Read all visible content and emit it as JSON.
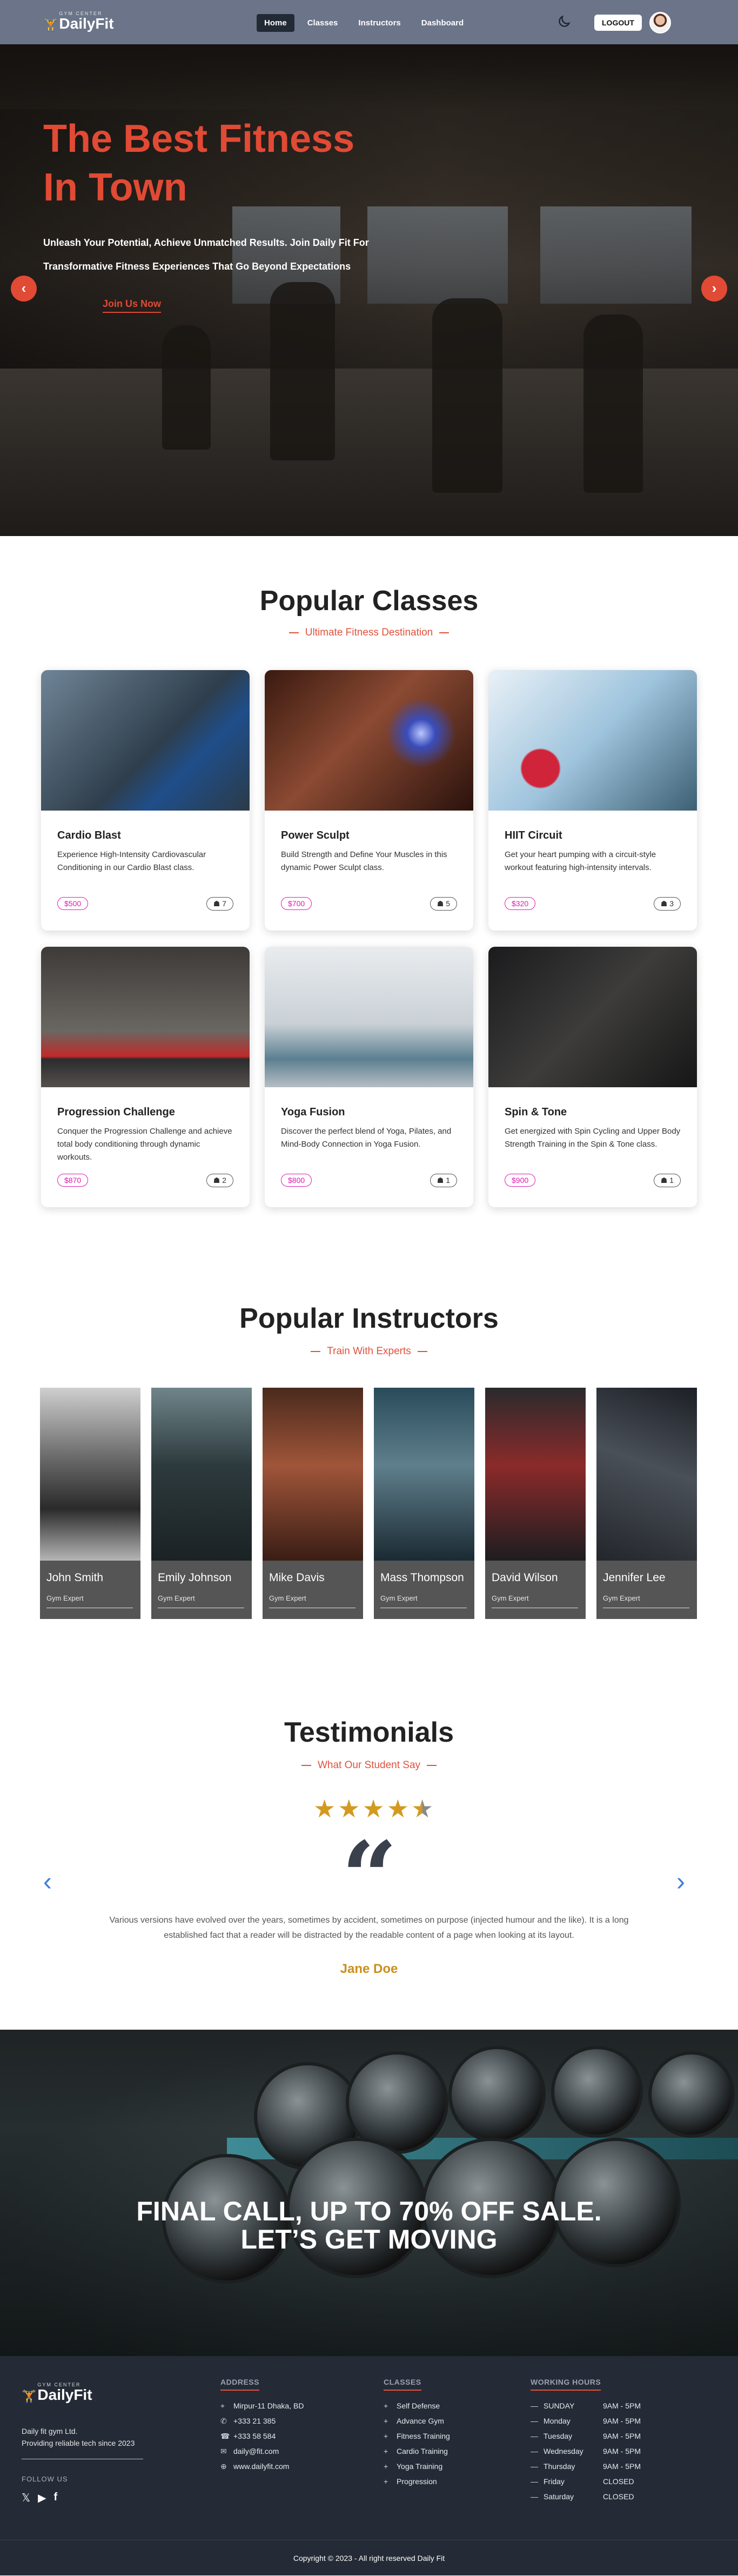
{
  "nav": {
    "logo_small": "GYM CENTER",
    "logo_big": "DailyFit",
    "links": [
      {
        "label": "Home",
        "active": true
      },
      {
        "label": "Classes",
        "active": false
      },
      {
        "label": "Instructors",
        "active": false
      },
      {
        "label": "Dashboard",
        "active": false
      }
    ],
    "logout_label": "LOGOUT"
  },
  "hero": {
    "title_line1": "The Best Fitness",
    "title_line2": "In Town",
    "subtitle": "Unleash Your Potential, Achieve Unmatched Results. Join Daily Fit For Transformative Fitness Experiences That Go Beyond Expectations",
    "cta": "Join Us Now",
    "prev_icon": "‹",
    "next_icon": "›",
    "accent": "#e14a34"
  },
  "classes": {
    "title": "Popular Classes",
    "subtitle": "Ultimate Fitness Destination",
    "items": [
      {
        "name": "Cardio Blast",
        "desc": "Experience High-Intensity Cardiovascular Conditioning in our Cardio Blast class.",
        "price": "$500",
        "seats": "7"
      },
      {
        "name": "Power Sculpt",
        "desc": "Build Strength and Define Your Muscles in this dynamic Power Sculpt class.",
        "price": "$700",
        "seats": "5"
      },
      {
        "name": "HIIT Circuit",
        "desc": "Get your heart pumping with a circuit-style workout featuring high-intensity intervals.",
        "price": "$320",
        "seats": "3"
      },
      {
        "name": "Progression Challenge",
        "desc": "Conquer the Progression Challenge and achieve total body conditioning through dynamic workouts.",
        "price": "$870",
        "seats": "2"
      },
      {
        "name": "Yoga Fusion",
        "desc": "Discover the perfect blend of Yoga, Pilates, and Mind-Body Connection in Yoga Fusion.",
        "price": "$800",
        "seats": "1"
      },
      {
        "name": "Spin & Tone",
        "desc": "Get energized with Spin Cycling and Upper Body Strength Training in the Spin & Tone class.",
        "price": "$900",
        "seats": "1"
      }
    ]
  },
  "instructors": {
    "title": "Popular Instructors",
    "subtitle": "Train With Experts",
    "items": [
      {
        "name": "John Smith",
        "role": "Gym Expert"
      },
      {
        "name": "Emily Johnson",
        "role": "Gym Expert"
      },
      {
        "name": "Mike Davis",
        "role": "Gym Expert"
      },
      {
        "name": "Mass Thompson",
        "role": "Gym Expert"
      },
      {
        "name": "David Wilson",
        "role": "Gym Expert"
      },
      {
        "name": "Jennifer Lee",
        "role": "Gym Expert"
      }
    ]
  },
  "testimonials": {
    "title": "Testimonials",
    "subtitle": "What Our Student Say",
    "rating": 4.5,
    "text": "Various versions have evolved over the years, sometimes by accident, sometimes on purpose (injected humour and the like). It is a long established fact that a reader will be distracted by the readable content of a page when looking at its layout.",
    "name": "Jane Doe",
    "prev_icon": "‹",
    "next_icon": "›"
  },
  "sale": {
    "line1": "FINAL CALL, UP TO 70% OFF SALE.",
    "line2": "LET’S GET MOVING"
  },
  "footer": {
    "tagline1": "Daily fit gym Ltd.",
    "tagline2": "Providing reliable tech since 2023",
    "follow": "FOLLOW US",
    "address_title": "ADDRESS",
    "address": [
      {
        "icon": "⌖",
        "text": "Mirpur-11 Dhaka, BD"
      },
      {
        "icon": "✆",
        "text": "+333 21 385"
      },
      {
        "icon": "☎",
        "text": "+333 58 584"
      },
      {
        "icon": "✉",
        "text": "daily@fit.com"
      },
      {
        "icon": "⊕",
        "text": "www.dailyfit.com"
      }
    ],
    "classes_title": "CLASSES",
    "classes": [
      "Self Defense",
      "Advance Gym",
      "Fitness Training",
      "Cardio Training",
      "Yoga Training",
      "Progression"
    ],
    "hours_title": "WORKING HOURS",
    "hours": [
      {
        "day": "SUNDAY",
        "time": "9AM - 5PM"
      },
      {
        "day": "Monday",
        "time": "9AM - 5PM"
      },
      {
        "day": "Tuesday",
        "time": "9AM - 5PM"
      },
      {
        "day": "Wednesday",
        "time": "9AM - 5PM"
      },
      {
        "day": "Thursday",
        "time": "9AM - 5PM"
      },
      {
        "day": "Friday",
        "time": "CLOSED"
      },
      {
        "day": "Saturday",
        "time": "CLOSED"
      }
    ],
    "copyright": "Copyright © 2023 - All right reserved Daily Fit"
  }
}
